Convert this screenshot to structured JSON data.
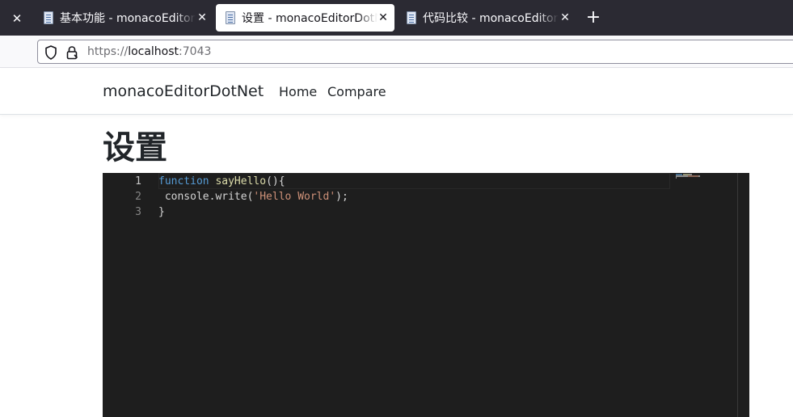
{
  "browser": {
    "tabs": [
      {
        "title": "基本功能 - monacoEditorDotNet",
        "active": false
      },
      {
        "title": "设置 - monacoEditorDotNet",
        "active": true
      },
      {
        "title": "代码比较 - monacoEditorDotNet",
        "active": false
      }
    ],
    "close_glyph": "✕",
    "new_tab_glyph": "+",
    "url": {
      "scheme": "https://",
      "host": "localhost",
      "port": ":7043"
    }
  },
  "site": {
    "brand": "monacoEditorDotNet",
    "nav": [
      {
        "label": "Home"
      },
      {
        "label": "Compare"
      }
    ]
  },
  "page": {
    "title": "设置"
  },
  "editor": {
    "theme": "vs-dark",
    "background": "#1e1e1e",
    "language": "javascript",
    "current_line": 1,
    "line_numbers": [
      "1",
      "2",
      "3"
    ],
    "lines": [
      {
        "tokens": [
          {
            "t": "function",
            "c": "kw"
          },
          {
            "t": " "
          },
          {
            "t": "sayHello",
            "c": "fn"
          },
          {
            "t": "(){"
          }
        ]
      },
      {
        "tokens": [
          {
            "t": " console.write("
          },
          {
            "t": "'Hello World'",
            "c": "str"
          },
          {
            "t": ");"
          }
        ]
      },
      {
        "tokens": [
          {
            "t": "}"
          }
        ]
      }
    ]
  },
  "colors": {
    "tab_strip": "#2b2a33",
    "keyword": "#569cd6",
    "function": "#dcdcaa",
    "string": "#ce9178",
    "text": "#d4d4d4"
  }
}
